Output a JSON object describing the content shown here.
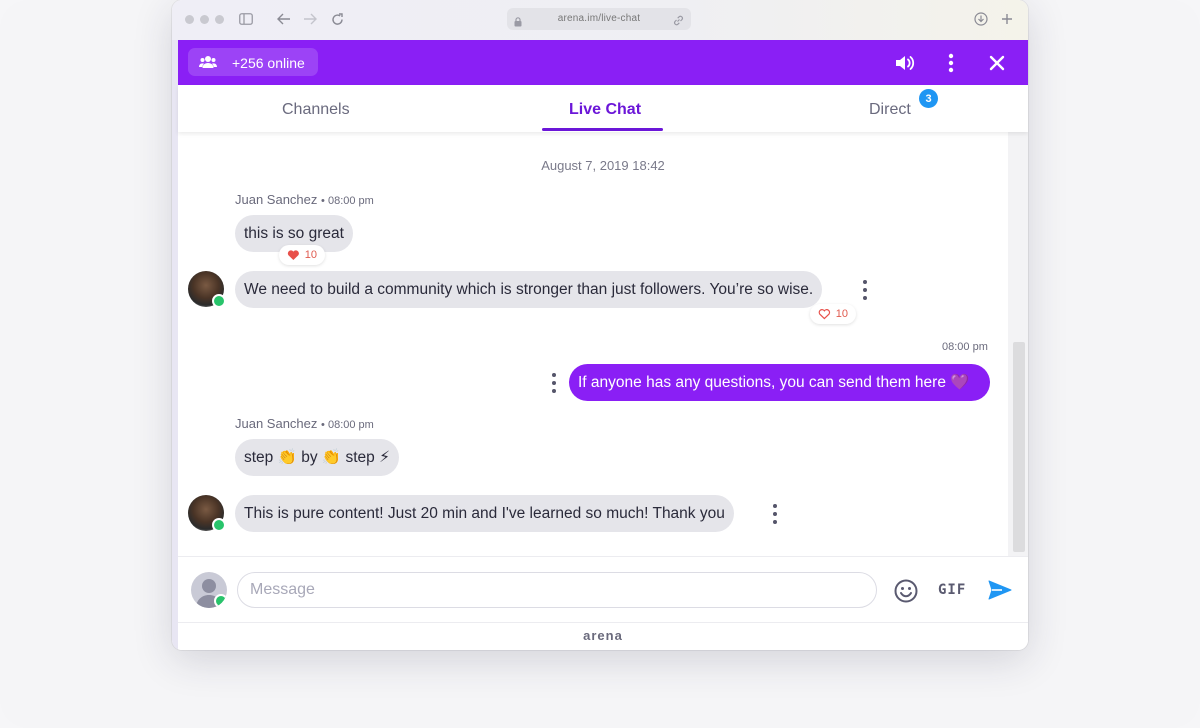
{
  "browser": {
    "url": "arena.im/live-chat"
  },
  "header": {
    "online_label": "+256 online"
  },
  "tabs": [
    {
      "label": "Channels"
    },
    {
      "label": "Live Chat"
    },
    {
      "label": "Direct",
      "badge": "3"
    }
  ],
  "messages": {
    "date_divider": "August 7, 2019 18:42",
    "group1": {
      "author": "Juan Sanchez",
      "time": "08:00 pm",
      "msg1": {
        "text": "this is so great",
        "reactions": "10"
      },
      "msg2": {
        "text": "We need to build a community which is stronger than just followers. You’re so wise.",
        "reactions": "10"
      }
    },
    "mine": {
      "time": "08:00 pm",
      "text": "If anyone has any questions, you can send them here 💜"
    },
    "group2": {
      "author": "Juan Sanchez",
      "time": "08:00 pm",
      "msg1": {
        "text": "step 👏 by 👏 step ⚡"
      },
      "msg2": {
        "text": "This is pure content! Just 20 min and I've learned so much! Thank you"
      }
    }
  },
  "composer": {
    "placeholder": "Message",
    "gif_label": "GIF"
  },
  "footer": {
    "brand": "arena"
  },
  "colors": {
    "primary": "#8a1ff5",
    "tab_active": "#6b16d8",
    "bubble": "#e5e5ea",
    "online": "#28c46b",
    "badge": "#1f96f3",
    "send": "#1f96f3"
  }
}
